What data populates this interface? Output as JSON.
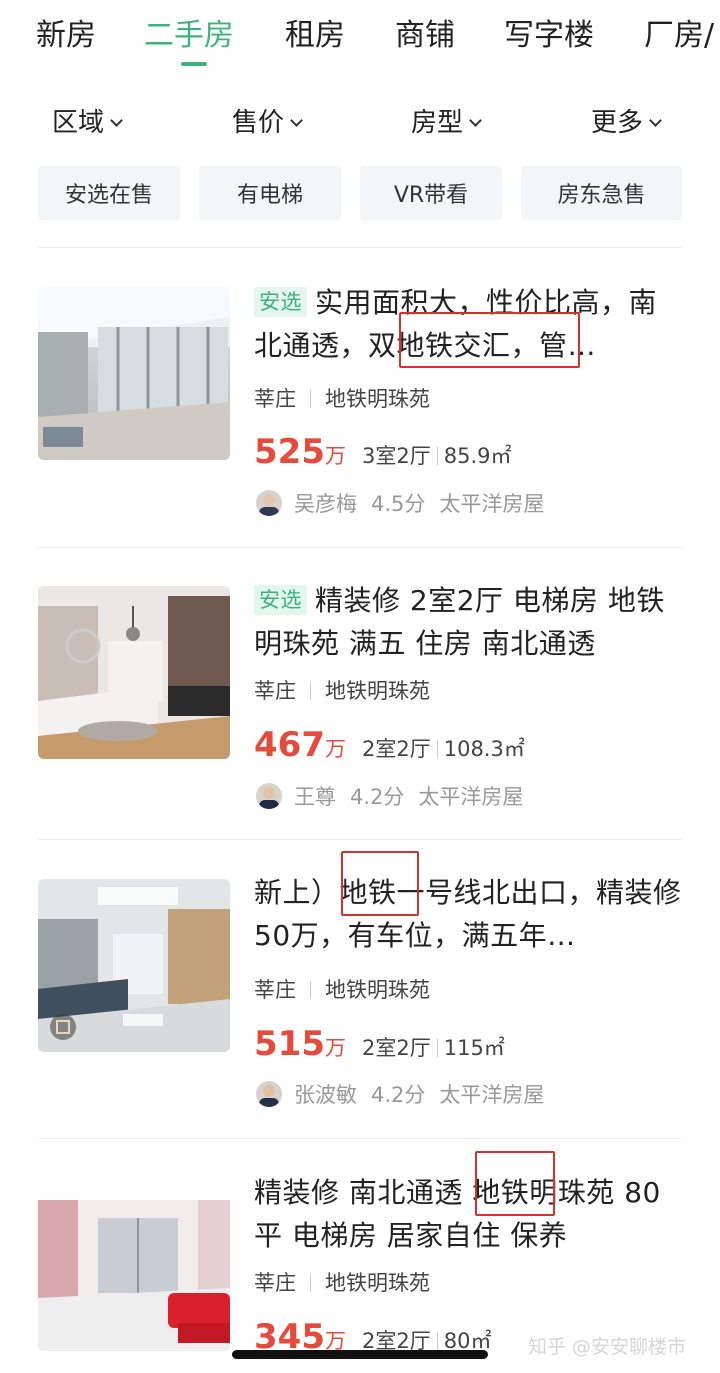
{
  "tabs": [
    {
      "label": "新房",
      "active": false
    },
    {
      "label": "二手房",
      "active": true
    },
    {
      "label": "租房",
      "active": false
    },
    {
      "label": "商铺",
      "active": false
    },
    {
      "label": "写字楼",
      "active": false
    },
    {
      "label": "厂房/",
      "active": false
    }
  ],
  "filters": [
    {
      "label": "区域"
    },
    {
      "label": "售价"
    },
    {
      "label": "房型"
    },
    {
      "label": "更多"
    }
  ],
  "chips": [
    {
      "label": "安选在售"
    },
    {
      "label": "有电梯"
    },
    {
      "label": "VR带看"
    },
    {
      "label": "房东急售"
    }
  ],
  "listings": [
    {
      "tag": "安选",
      "title": "实用面积大，性价比高，南北通透，双地铁交汇，管…",
      "district": "莘庄",
      "community": "地铁明珠苑",
      "price": "525",
      "price_unit": "万",
      "layout": "3室2厅",
      "area": "85.9㎡",
      "agent": "吴彦梅",
      "score": "4.5分",
      "agency": "太平洋房屋"
    },
    {
      "tag": "安选",
      "title": "精装修 2室2厅 电梯房 地铁明珠苑 满五 住房 南北通透",
      "district": "莘庄",
      "community": "地铁明珠苑",
      "price": "467",
      "price_unit": "万",
      "layout": "2室2厅",
      "area": "108.3㎡",
      "agent": "王尊",
      "score": "4.2分",
      "agency": "太平洋房屋"
    },
    {
      "tag": "",
      "title": "新上）地铁一号线北出口，精装修50万，有车位，满五年…",
      "district": "莘庄",
      "community": "地铁明珠苑",
      "price": "515",
      "price_unit": "万",
      "layout": "2室2厅",
      "area": "115㎡",
      "agent": "张波敏",
      "score": "4.2分",
      "agency": "太平洋房屋"
    },
    {
      "tag": "",
      "title": "精装修 南北通透 地铁明珠苑 80平 电梯房 居家自住 保养",
      "district": "莘庄",
      "community": "地铁明珠苑",
      "price": "345",
      "price_unit": "万",
      "layout": "2室2厅",
      "area": "80㎡"
    }
  ],
  "watermark": "知乎 @安安聊楼市",
  "colors": {
    "accent": "#3bb47c",
    "price": "#e64a3b",
    "highlight_box": "#d8312b"
  }
}
